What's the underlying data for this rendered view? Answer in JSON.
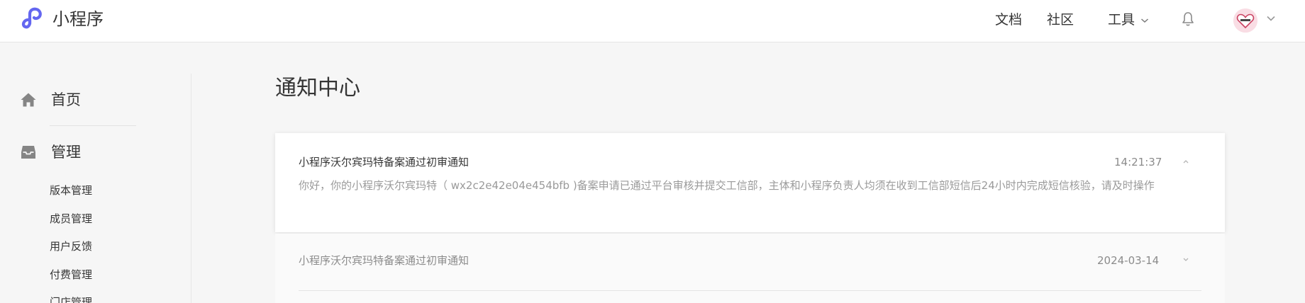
{
  "header": {
    "brand": "小程序",
    "nav": {
      "docs": "文档",
      "community": "社区",
      "tools": "工具"
    },
    "icons": {
      "logo": "miniprogram-logo-icon",
      "bell": "bell-icon",
      "avatar": "user-avatar"
    },
    "accent": "#6467f0"
  },
  "sidebar": {
    "home": {
      "label": "首页",
      "icon": "home-icon"
    },
    "manage": {
      "label": "管理",
      "icon": "inbox-icon"
    },
    "items": [
      "版本管理",
      "成员管理",
      "用户反馈",
      "付费管理",
      "门店管理"
    ]
  },
  "main": {
    "title": "通知中心",
    "notifications": [
      {
        "title": "小程序沃尔宾玛特备案通过初审通知",
        "time": "14:21:37",
        "body": "你好，你的小程序沃尔宾玛特（ wx2c2e42e04e454bfb )备案申请已通过平台审核并提交工信部，主体和小程序负责人均须在收到工信部短信后24小时内完成短信核验，请及时操作",
        "expanded": true
      },
      {
        "title": "小程序沃尔宾玛特备案通过初审通知",
        "time": "2024-03-14",
        "expanded": false
      }
    ]
  }
}
